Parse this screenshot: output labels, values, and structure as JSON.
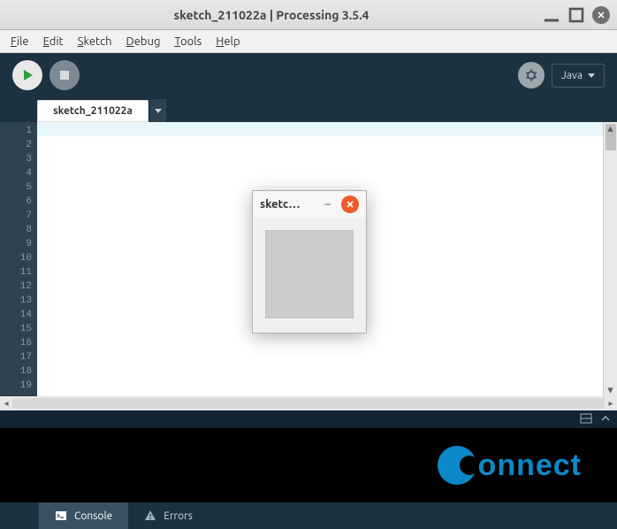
{
  "window": {
    "title": "sketch_211022a | Processing 3.5.4"
  },
  "menu": {
    "file": "File",
    "edit": "Edit",
    "sketch": "Sketch",
    "debug": "Debug",
    "tools": "Tools",
    "help": "Help"
  },
  "toolbar": {
    "mode_label": "Java"
  },
  "tabs": {
    "active": "sketch_211022a"
  },
  "editor": {
    "line_numbers": [
      "1",
      "2",
      "3",
      "4",
      "5",
      "6",
      "7",
      "8",
      "9",
      "10",
      "11",
      "12",
      "13",
      "14",
      "15",
      "16",
      "17",
      "18",
      "19"
    ]
  },
  "bottom": {
    "console_label": "Console",
    "errors_label": "Errors"
  },
  "brand": {
    "text": "onnect"
  },
  "sketch_popup": {
    "title": "sketc…"
  }
}
